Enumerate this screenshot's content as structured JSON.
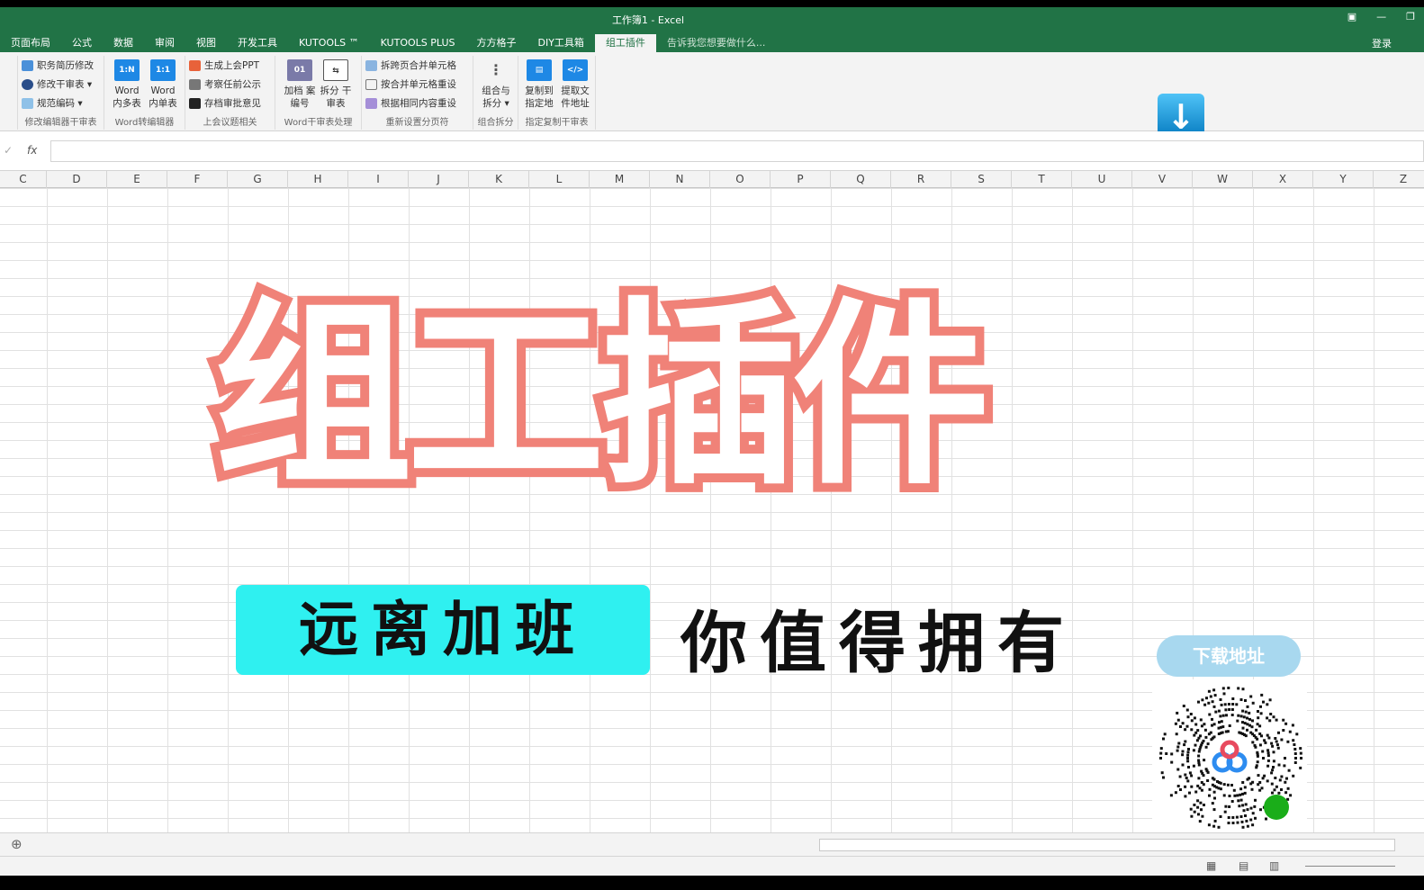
{
  "window": {
    "title": "工作簿1 - Excel",
    "login": "登录"
  },
  "tabs": [
    "页面布局",
    "公式",
    "数据",
    "审阅",
    "视图",
    "开发工具",
    "KUTOOLS ™",
    "KUTOOLS PLUS",
    "方方格子",
    "DIY工具箱",
    "组工插件"
  ],
  "active_tab": "组工插件",
  "tell_me": "告诉我您想要做什么...",
  "ribbon": {
    "g1": {
      "items": [
        "职务简历修改",
        "修改干审表 ▾",
        "规范编码 ▾"
      ],
      "label": "修改编辑器干审表"
    },
    "g2": {
      "buttons": [
        {
          "icon": "1:N",
          "label": "Word 内多表"
        },
        {
          "icon": "1:1",
          "label": "Word 内单表"
        }
      ],
      "label": "Word转编辑器"
    },
    "g3": {
      "items": [
        "生成上会PPT",
        "考察任前公示",
        "存档审批意见"
      ],
      "label": "上会议题相关"
    },
    "g4": {
      "buttons": [
        {
          "icon": "01",
          "label": "加档 案编号"
        },
        {
          "icon": "⇆",
          "label": "拆分 干审表"
        }
      ],
      "label": "Word干审表处理"
    },
    "g5": {
      "items": [
        "拆跨页合并单元格",
        "按合并单元格重设",
        "根据相同内容重设"
      ],
      "label": "重新设置分页符"
    },
    "g6": {
      "buttons": [
        {
          "icon": "⋮",
          "label": "组合与 拆分 ▾"
        }
      ],
      "label": "组合拆分"
    },
    "g7": {
      "buttons": [
        {
          "icon": "▤",
          "label": "复制到 指定地"
        },
        {
          "icon": "</>",
          "label": "提取文 件地址"
        }
      ],
      "label": "指定复制干审表"
    }
  },
  "formula": {
    "fx": "fx",
    "value": ""
  },
  "columns": [
    "C",
    "D",
    "E",
    "F",
    "G",
    "H",
    "I",
    "J",
    "K",
    "L",
    "M",
    "N",
    "O",
    "P",
    "Q",
    "R",
    "S",
    "T",
    "U",
    "V",
    "W",
    "X",
    "Y",
    "Z"
  ],
  "overlay": {
    "title": "组工插件",
    "tagline": "远离加班",
    "slogan": "你值得拥有",
    "download": "下载地址"
  },
  "colors": {
    "excel_green": "#217346",
    "title_outline": "#f08278",
    "tagline_bg": "#2ff0f0"
  }
}
